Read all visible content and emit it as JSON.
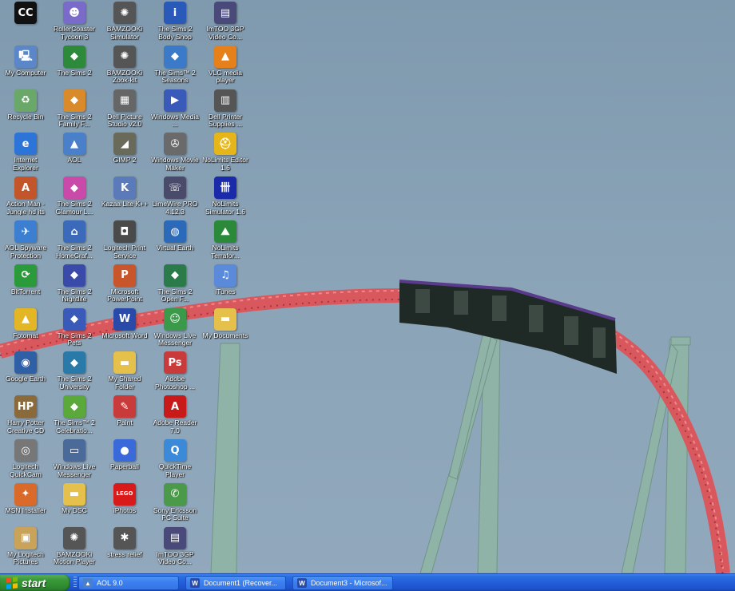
{
  "desktop": {
    "icons": [
      {
        "label": "",
        "icon": "cc-icon",
        "glyph": "CC",
        "color": "#111111",
        "col": 0,
        "row": 0
      },
      {
        "label": "My Computer",
        "icon": "computer-icon",
        "glyph": "🖳",
        "color": "#5b87c9",
        "col": 0,
        "row": 1
      },
      {
        "label": "Recycle Bin",
        "icon": "recycle-bin-icon",
        "glyph": "♻",
        "color": "#6aa86a",
        "col": 0,
        "row": 2
      },
      {
        "label": "Internet Explorer",
        "icon": "internet-explorer-icon",
        "glyph": "e",
        "color": "#2d74d9",
        "col": 0,
        "row": 3
      },
      {
        "label": "Action Man - Jungle hd its",
        "icon": "action-man-icon",
        "glyph": "A",
        "color": "#c2552a",
        "col": 0,
        "row": 4
      },
      {
        "label": "AOL Spyware Protection",
        "icon": "aol-spyware-icon",
        "glyph": "✈",
        "color": "#3c7ecf",
        "col": 0,
        "row": 5
      },
      {
        "label": "BitTorrent",
        "icon": "bittorrent-icon",
        "glyph": "⟳",
        "color": "#2a9a3a",
        "col": 0,
        "row": 6
      },
      {
        "label": "Fotomat",
        "icon": "fotomat-icon",
        "glyph": "▲",
        "color": "#e2b625",
        "col": 0,
        "row": 7
      },
      {
        "label": "Google Earth",
        "icon": "google-earth-icon",
        "glyph": "◉",
        "color": "#2f5fa5",
        "col": 0,
        "row": 8
      },
      {
        "label": "Harry Potter Creative CD",
        "icon": "harry-potter-icon",
        "glyph": "HP",
        "color": "#8a6a3a",
        "col": 0,
        "row": 9
      },
      {
        "label": "Logitech QuickCam",
        "icon": "quickcam-icon",
        "glyph": "◎",
        "color": "#777777",
        "col": 0,
        "row": 10
      },
      {
        "label": "MSN Installer",
        "icon": "msn-installer-icon",
        "glyph": "✦",
        "color": "#d96a2a",
        "col": 0,
        "row": 11
      },
      {
        "label": "My Logitech Pictures",
        "icon": "logitech-pictures-icon",
        "glyph": "▣",
        "color": "#c9a35a",
        "col": 0,
        "row": 12
      },
      {
        "label": "RollerCoaster Tycoon 3",
        "icon": "rollercoaster-tycoon-icon",
        "glyph": "☻",
        "color": "#7a6ac9",
        "col": 1,
        "row": 0
      },
      {
        "label": "The Sims 2",
        "icon": "sims2-icon",
        "glyph": "◆",
        "color": "#2d8a3a",
        "col": 1,
        "row": 1
      },
      {
        "label": "The Sims 2 Family F...",
        "icon": "sims2-family-icon",
        "glyph": "◆",
        "color": "#d98a2a",
        "col": 1,
        "row": 2
      },
      {
        "label": "AOL",
        "icon": "aol-icon",
        "glyph": "▲",
        "color": "#4a7fc9",
        "col": 1,
        "row": 3
      },
      {
        "label": "The Sims 2 Glamour L...",
        "icon": "sims2-glamour-icon",
        "glyph": "◆",
        "color": "#c94aa9",
        "col": 1,
        "row": 4
      },
      {
        "label": "The Sims 2 HomeCraf...",
        "icon": "sims2-homecraft-icon",
        "glyph": "⌂",
        "color": "#3a6ab9",
        "col": 1,
        "row": 5
      },
      {
        "label": "The Sims 2 Nightlife",
        "icon": "sims2-nightlife-icon",
        "glyph": "◆",
        "color": "#3a4aa9",
        "col": 1,
        "row": 6
      },
      {
        "label": "The Sims 2 Pets",
        "icon": "sims2-pets-icon",
        "glyph": "◆",
        "color": "#3a5ab9",
        "col": 1,
        "row": 7
      },
      {
        "label": "The Sims 2 University",
        "icon": "sims2-university-icon",
        "glyph": "◆",
        "color": "#2a7aa9",
        "col": 1,
        "row": 8
      },
      {
        "label": "The Sims™ 2 Celebratio...",
        "icon": "sims2-celebration-icon",
        "glyph": "◆",
        "color": "#5aa93a",
        "col": 1,
        "row": 9
      },
      {
        "label": "Windows Live Messenger",
        "icon": "live-messenger-icon",
        "glyph": "▭",
        "color": "#4a6a9a",
        "col": 1,
        "row": 10
      },
      {
        "label": "My DSC",
        "icon": "folder-icon",
        "glyph": "▬",
        "color": "#e5c04a",
        "col": 1,
        "row": 11
      },
      {
        "label": "BAMZOOKi Motion Player",
        "icon": "bamzooki-motion-icon",
        "glyph": "✺",
        "color": "#555555",
        "col": 1,
        "row": 12
      },
      {
        "label": "BAMZOOKi Simulator",
        "icon": "bamzooki-simulator-icon",
        "glyph": "✺",
        "color": "#555555",
        "col": 2,
        "row": 0
      },
      {
        "label": "BAMZOOKi Zook-kit",
        "icon": "bamzooki-zookkit-icon",
        "glyph": "✺",
        "color": "#555555",
        "col": 2,
        "row": 1
      },
      {
        "label": "Dell Picture Studio v2.0",
        "icon": "dell-picture-studio-icon",
        "glyph": "▦",
        "color": "#666666",
        "col": 2,
        "row": 2
      },
      {
        "label": "GIMP 2",
        "icon": "gimp-icon",
        "glyph": "◢",
        "color": "#6a6a5a",
        "col": 2,
        "row": 3
      },
      {
        "label": "Kazaa Lite K++",
        "icon": "kazaa-icon",
        "glyph": "K",
        "color": "#5a7ab9",
        "col": 2,
        "row": 4
      },
      {
        "label": "Logitech Print Service",
        "icon": "logitech-print-icon",
        "glyph": "◘",
        "color": "#4a4a4a",
        "col": 2,
        "row": 5
      },
      {
        "label": "Microsoft PowerPoint",
        "icon": "powerpoint-icon",
        "glyph": "P",
        "color": "#c9552a",
        "col": 2,
        "row": 6
      },
      {
        "label": "Microsoft Word",
        "icon": "word-icon",
        "glyph": "W",
        "color": "#2a4aa9",
        "col": 2,
        "row": 7
      },
      {
        "label": "My Shared Folder",
        "icon": "shared-folder-icon",
        "glyph": "▬",
        "color": "#e5c04a",
        "col": 2,
        "row": 8
      },
      {
        "label": "Paint",
        "icon": "paint-icon",
        "glyph": "✎",
        "color": "#c93a3a",
        "col": 2,
        "row": 9
      },
      {
        "label": "Paperball",
        "icon": "paperball-icon",
        "glyph": "●",
        "color": "#3a6ad9",
        "col": 2,
        "row": 10
      },
      {
        "label": "iPhotos",
        "icon": "lego-icon",
        "glyph": "LEGO",
        "color": "#d91a1a",
        "col": 2,
        "row": 11
      },
      {
        "label": "stress relief",
        "icon": "stress-relief-icon",
        "glyph": "✱",
        "color": "#555555",
        "col": 2,
        "row": 12
      },
      {
        "label": "The Sims 2 Body Shop",
        "icon": "sims2-bodyshop-icon",
        "glyph": "i",
        "color": "#2a5ab9",
        "col": 3,
        "row": 0
      },
      {
        "label": "The Sims™ 2 Seasons",
        "icon": "sims2-seasons-icon",
        "glyph": "◆",
        "color": "#3a7ac9",
        "col": 3,
        "row": 1
      },
      {
        "label": "Windows Media ...",
        "icon": "windows-media-icon",
        "glyph": "▶",
        "color": "#3a5ab9",
        "col": 3,
        "row": 2
      },
      {
        "label": "Windows Movie Maker",
        "icon": "movie-maker-icon",
        "glyph": "✇",
        "color": "#6a6a6a",
        "col": 3,
        "row": 3
      },
      {
        "label": "LimeWire PRO 4.12.3",
        "icon": "limewire-icon",
        "glyph": "☏",
        "color": "#4a4a6a",
        "col": 3,
        "row": 4
      },
      {
        "label": "Virtual Earth",
        "icon": "virtual-earth-icon",
        "glyph": "◍",
        "color": "#2a6ab9",
        "col": 3,
        "row": 5
      },
      {
        "label": "The Sims 2 Open F...",
        "icon": "sims2-openforbusiness-icon",
        "glyph": "◆",
        "color": "#2a7a4a",
        "col": 3,
        "row": 6
      },
      {
        "label": "Windows Live Messenger",
        "icon": "messenger-people-icon",
        "glyph": "☺",
        "color": "#3a9a4a",
        "col": 3,
        "row": 7
      },
      {
        "label": "Adobe Photoshop ...",
        "icon": "photoshop-icon",
        "glyph": "Ps",
        "color": "#c93a3a",
        "col": 3,
        "row": 8
      },
      {
        "label": "Adobe Reader 7.0",
        "icon": "adobe-reader-icon",
        "glyph": "A",
        "color": "#c91a1a",
        "col": 3,
        "row": 9
      },
      {
        "label": "QuickTime Player",
        "icon": "quicktime-icon",
        "glyph": "Q",
        "color": "#3a8ad9",
        "col": 3,
        "row": 10
      },
      {
        "label": "Sony Ericsson PC Suite",
        "icon": "sony-ericsson-icon",
        "glyph": "✆",
        "color": "#4a9a4a",
        "col": 3,
        "row": 11
      },
      {
        "label": "ImTOO 3GP Video Co...",
        "icon": "imtoo-3gp-icon",
        "glyph": "▤",
        "color": "#4a4a7a",
        "col": 3,
        "row": 12
      },
      {
        "label": "ImTOO 3GP Video Co...",
        "icon": "imtoo-3gp-icon",
        "glyph": "▤",
        "color": "#4a4a7a",
        "col": 4,
        "row": 0
      },
      {
        "label": "VLC media player",
        "icon": "vlc-icon",
        "glyph": "▲",
        "color": "#e5801a",
        "col": 4,
        "row": 1
      },
      {
        "label": "Dell Printer Supplies ...",
        "icon": "dell-printer-icon",
        "glyph": "▥",
        "color": "#555555",
        "col": 4,
        "row": 2
      },
      {
        "label": "NoLimits Editor 1.6",
        "icon": "nolimits-editor-icon",
        "glyph": "⛑",
        "color": "#e5b51a",
        "col": 4,
        "row": 3
      },
      {
        "label": "NoLimits Simulator 1.6",
        "icon": "nolimits-simulator-icon",
        "glyph": "卌",
        "color": "#1a2aa9",
        "col": 4,
        "row": 4
      },
      {
        "label": "NoLimits Terrafor...",
        "icon": "nolimits-terraformer-icon",
        "glyph": "⛰",
        "color": "#2a8a3a",
        "col": 4,
        "row": 5
      },
      {
        "label": "iTunes",
        "icon": "itunes-icon",
        "glyph": "♫",
        "color": "#5a8ad9",
        "col": 4,
        "row": 6
      },
      {
        "label": "My Documents",
        "icon": "my-documents-icon",
        "glyph": "▬",
        "color": "#e5c04a",
        "col": 4,
        "row": 7
      }
    ]
  },
  "taskbar": {
    "start_label": "start",
    "tasks": [
      {
        "label": "AOL 9.0",
        "icon": "aol-task-icon",
        "glyph": "▲",
        "color": "#4a7fc9"
      },
      {
        "label": "Document1 (Recover...",
        "icon": "word-task-icon",
        "glyph": "W",
        "color": "#2a4aa9"
      },
      {
        "label": "Document3 - Microsof...",
        "icon": "word-task-icon",
        "glyph": "W",
        "color": "#2a4aa9"
      }
    ]
  },
  "colors": {
    "sky": "#8aa3b7",
    "track_red": "#d4555a",
    "support_green": "#8fb5a8",
    "taskbar_blue": "#245edb",
    "start_green": "#3c9a3c"
  }
}
